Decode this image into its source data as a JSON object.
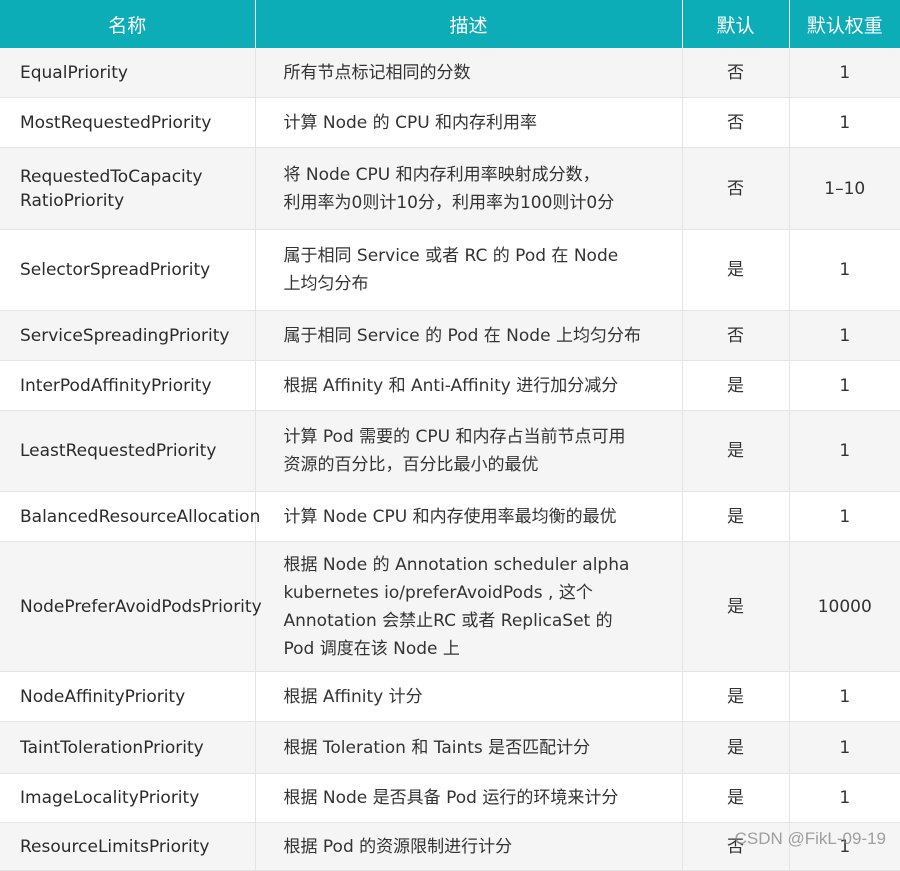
{
  "header": {
    "name": "名称",
    "description": "描述",
    "default": "默认",
    "default_weight": "默认权重"
  },
  "rows": [
    {
      "name": "EqualPriority",
      "description": "所有节点标记相同的分数",
      "default": "否",
      "weight": "1"
    },
    {
      "name": "MostRequestedPriority",
      "description": "计算 Node 的 CPU 和内存利用率",
      "default": "否",
      "weight": "1"
    },
    {
      "name": "RequestedToCapacity\nRatioPriority",
      "description": "将 Node CPU 和内存利用率映射成分数，\n利用率为0则计10分，利用率为100则计0分",
      "default": "否",
      "weight": "1–10"
    },
    {
      "name": "SelectorSpreadPriority",
      "description": "属于相同 Service 或者 RC 的 Pod 在 Node\n上均匀分布",
      "default": "是",
      "weight": "1"
    },
    {
      "name": "ServiceSpreadingPriority",
      "description": "属于相同 Service 的 Pod 在 Node 上均匀分布",
      "default": "否",
      "weight": "1"
    },
    {
      "name": "InterPodAffinityPriority",
      "description": "根据 Affinity 和 Anti-Affinity 进行加分减分",
      "default": "是",
      "weight": "1"
    },
    {
      "name": "LeastRequestedPriority",
      "description": "计算 Pod 需要的 CPU 和内存占当前节点可用\n资源的百分比，百分比最小的最优",
      "default": "是",
      "weight": "1"
    },
    {
      "name": "BalancedResourceAllocation",
      "description": "计算 Node CPU 和内存使用率最均衡的最优",
      "default": "是",
      "weight": "1"
    },
    {
      "name": "NodePreferAvoidPodsPriority",
      "description": "根据 Node 的 Annotation scheduler  alpha\nkubernetes io/preferAvoidPods , 这个\nAnnotation 会禁止RC 或者 ReplicaSet 的\nPod 调度在该 Node 上",
      "default": "是",
      "weight": "10000"
    },
    {
      "name": "NodeAffinityPriority",
      "description": "根据 Affinity 计分",
      "default": "是",
      "weight": "1"
    },
    {
      "name": "TaintTolerationPriority",
      "description": "根据 Toleration 和 Taints 是否匹配计分",
      "default": "是",
      "weight": "1"
    },
    {
      "name": "ImageLocalityPriority",
      "description": "根据 Node 是否具备 Pod 运行的环境来计分",
      "default": "是",
      "weight": "1"
    },
    {
      "name": "ResourceLimitsPriority",
      "description": "根据 Pod 的资源限制进行计分",
      "default": "否",
      "weight": "1"
    }
  ],
  "watermark": "CSDN @FikL-09-19"
}
